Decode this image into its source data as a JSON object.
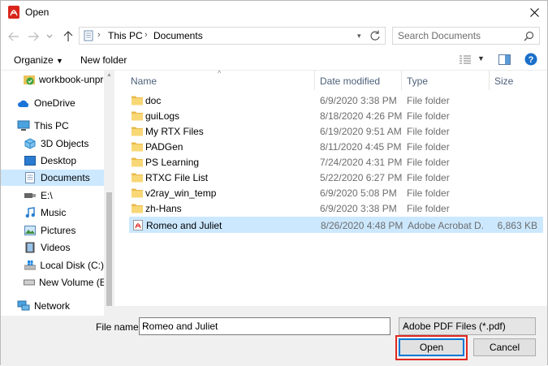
{
  "window": {
    "title": "Open"
  },
  "address": {
    "crumbs": [
      "This PC",
      "Documents"
    ],
    "search_placeholder": "Search Documents"
  },
  "toolbar": {
    "organize_label": "Organize",
    "new_folder_label": "New folder"
  },
  "nav": {
    "items": [
      {
        "label": "workbook-unpro",
        "icon": "checked-folder-icon"
      },
      {
        "label": "OneDrive",
        "icon": "cloud-icon"
      },
      {
        "label": "This PC",
        "icon": "computer-icon"
      },
      {
        "label": "3D Objects",
        "icon": "cube-icon"
      },
      {
        "label": "Desktop",
        "icon": "desktop-icon"
      },
      {
        "label": "Documents",
        "icon": "documents-icon"
      },
      {
        "label": "E:\\",
        "icon": "usb-drive-icon"
      },
      {
        "label": "Music",
        "icon": "music-icon"
      },
      {
        "label": "Pictures",
        "icon": "pictures-icon"
      },
      {
        "label": "Videos",
        "icon": "videos-icon"
      },
      {
        "label": "Local Disk (C:)",
        "icon": "windows-drive-icon"
      },
      {
        "label": "New Volume (E:)",
        "icon": "drive-icon"
      },
      {
        "label": "Network",
        "icon": "network-icon"
      }
    ],
    "selected_index": 5
  },
  "columns": {
    "name": "Name",
    "date": "Date modified",
    "type": "Type",
    "size": "Size"
  },
  "files": [
    {
      "name": "doc",
      "date": "6/9/2020 3:38 PM",
      "type": "File folder",
      "size": "",
      "icon": "folder-icon"
    },
    {
      "name": "guiLogs",
      "date": "8/18/2020 4:26 PM",
      "type": "File folder",
      "size": "",
      "icon": "folder-icon"
    },
    {
      "name": "My RTX Files",
      "date": "6/19/2020 9:51 AM",
      "type": "File folder",
      "size": "",
      "icon": "folder-icon"
    },
    {
      "name": "PADGen",
      "date": "8/11/2020 4:45 PM",
      "type": "File folder",
      "size": "",
      "icon": "folder-icon"
    },
    {
      "name": "PS Learning",
      "date": "7/24/2020 4:31 PM",
      "type": "File folder",
      "size": "",
      "icon": "folder-icon"
    },
    {
      "name": "RTXC File List",
      "date": "5/22/2020 6:27 PM",
      "type": "File folder",
      "size": "",
      "icon": "folder-icon"
    },
    {
      "name": "v2ray_win_temp",
      "date": "6/9/2020 5:08 PM",
      "type": "File folder",
      "size": "",
      "icon": "folder-icon"
    },
    {
      "name": "zh-Hans",
      "date": "6/9/2020 3:38 PM",
      "type": "File folder",
      "size": "",
      "icon": "folder-icon"
    },
    {
      "name": "Romeo and Juliet",
      "date": "8/26/2020 4:48 PM",
      "type": "Adobe Acrobat D...",
      "size": "6,863 KB",
      "icon": "pdf-icon"
    }
  ],
  "selected_file_index": 8,
  "bottom": {
    "file_name_label": "File name:",
    "file_name_value": "Romeo and Juliet",
    "file_type_value": "Adobe PDF Files (*.pdf)",
    "open_label": "Open",
    "cancel_label": "Cancel"
  },
  "colors": {
    "accent": "#0078d7",
    "selection": "#cce8ff",
    "highlight": "#e0281f",
    "folder": "#f8d775"
  }
}
